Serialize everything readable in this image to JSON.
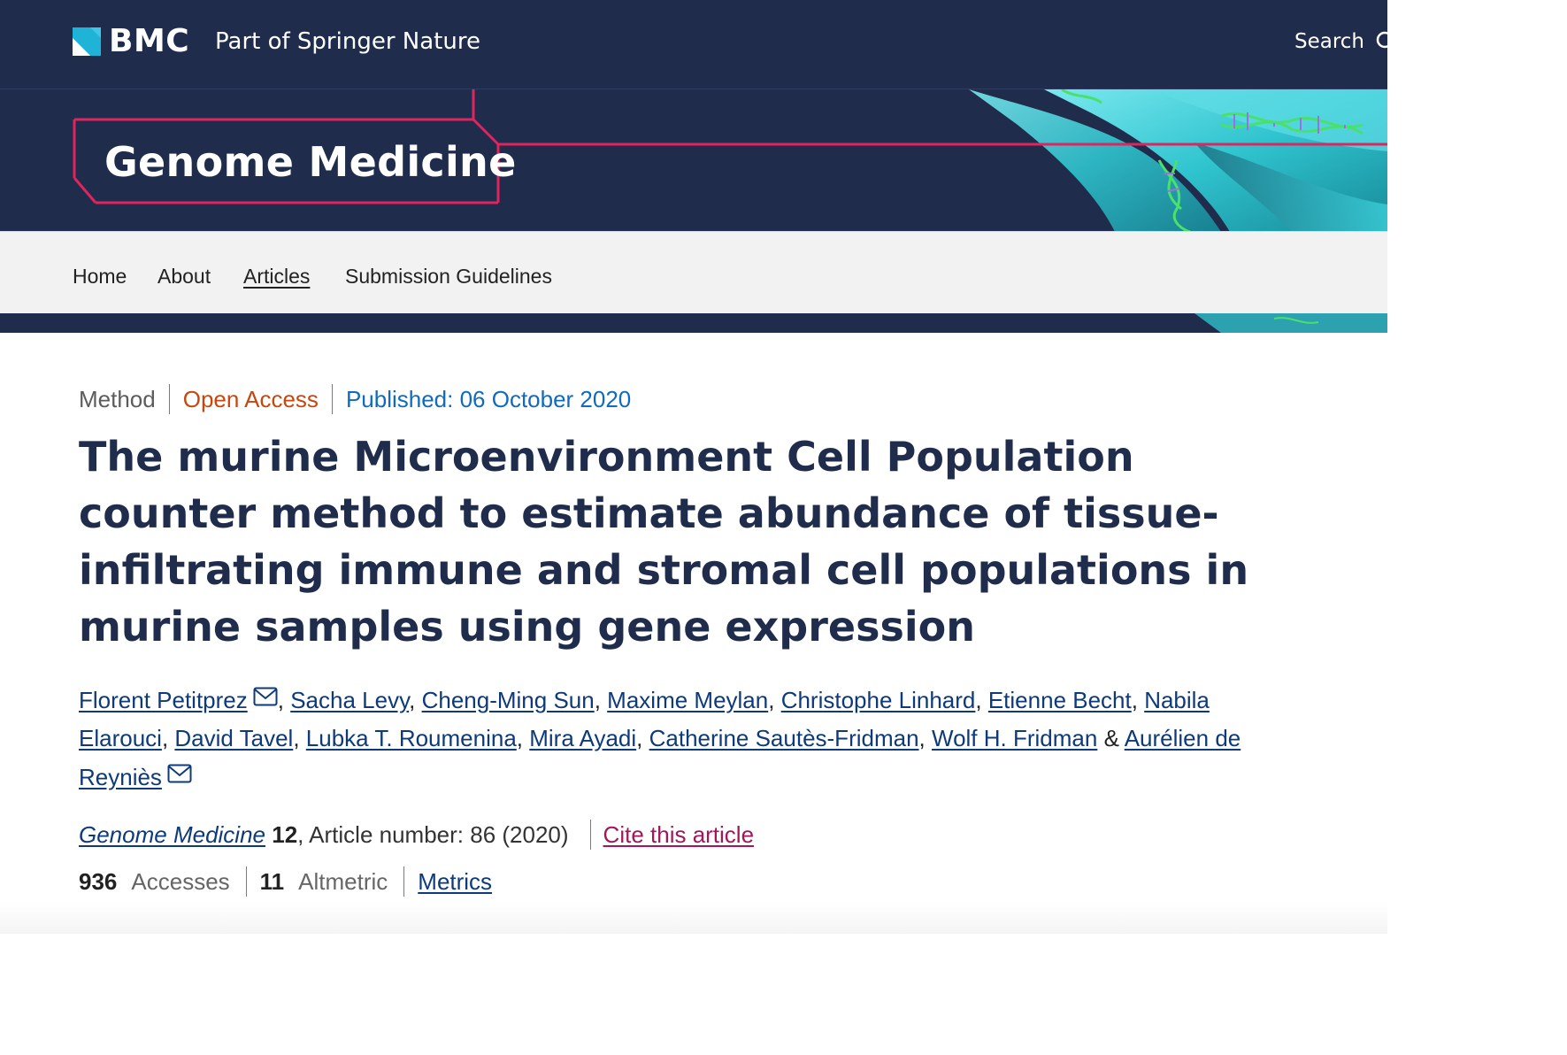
{
  "header": {
    "logo_text": "BMC",
    "tagline": "Part of Springer Nature",
    "search_label": "Search"
  },
  "banner": {
    "journal_title": "Genome Medicine"
  },
  "nav": {
    "items": [
      {
        "label": "Home",
        "active": false
      },
      {
        "label": "About",
        "active": false
      },
      {
        "label": "Articles",
        "active": true
      },
      {
        "label": "Submission Guidelines",
        "active": false
      }
    ]
  },
  "article": {
    "type": "Method",
    "access": "Open Access",
    "published": "Published: 06 October 2020",
    "title": "The murine Microenvironment Cell Population counter method to estimate abundance of tissue-infiltrating immune and stromal cell populations in murine samples using gene expression",
    "authors": [
      {
        "name": "Florent Petitprez",
        "email": true
      },
      {
        "name": "Sacha Levy",
        "email": false
      },
      {
        "name": "Cheng-Ming Sun",
        "email": false
      },
      {
        "name": "Maxime Meylan",
        "email": false
      },
      {
        "name": "Christophe Linhard",
        "email": false
      },
      {
        "name": "Etienne Becht",
        "email": false
      },
      {
        "name": "Nabila Elarouci",
        "email": false
      },
      {
        "name": "David Tavel",
        "email": false
      },
      {
        "name": "Lubka T. Roumenina",
        "email": false
      },
      {
        "name": "Mira Ayadi",
        "email": false
      },
      {
        "name": "Catherine Sautès-Fridman",
        "email": false
      },
      {
        "name": "Wolf H. Fridman",
        "email": false
      },
      {
        "name": "Aurélien de Reyniès",
        "email": true
      }
    ],
    "author_separator": ", ",
    "author_last_separator": " & ",
    "citation": {
      "journal": "Genome Medicine",
      "volume": "12",
      "article_number": ", Article number: 86 (2020)",
      "cite_label": "Cite this article"
    },
    "metrics": {
      "accesses_count": "936",
      "accesses_label": "Accesses",
      "altmetric_count": "11",
      "altmetric_label": "Altmetric",
      "metrics_link": "Metrics"
    }
  },
  "colors": {
    "navy": "#1f2c4c",
    "accent_pink": "#e0245e",
    "open_access": "#c8470e",
    "published": "#0e6bbd",
    "link": "#0e3a7a",
    "cite_link": "#a0185a"
  },
  "icons": [
    "bmc-logo-icon",
    "search-icon",
    "email-icon"
  ]
}
